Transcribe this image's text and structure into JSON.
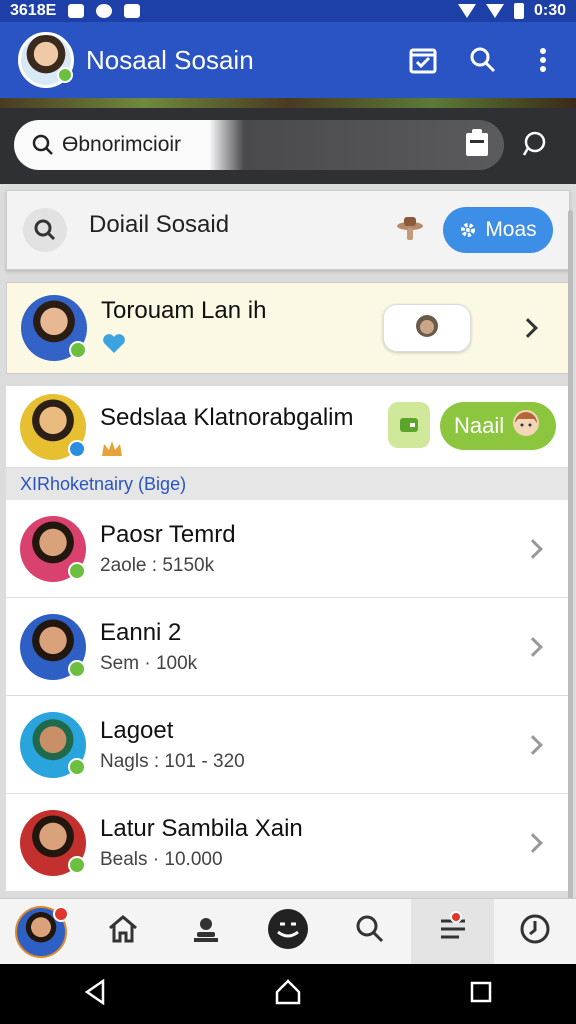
{
  "status_bar": {
    "left_text": "3618E",
    "time": "0:30"
  },
  "app_bar": {
    "title": "Nosaal Sosain",
    "avatar_icon": "profile-avatar",
    "actions": [
      "calendar-check-icon",
      "search-icon",
      "more-vert-icon"
    ]
  },
  "search": {
    "value": "Ɵbnorimcioir"
  },
  "detail": {
    "title": "Doiail Sosaid",
    "button_label": "Moas"
  },
  "rows": [
    {
      "name": "Torouam Lan ih",
      "sub": "",
      "verified": "green"
    },
    {
      "name": "Sedslaa Klatnorabgalim",
      "sub": "",
      "action_label": "Naail",
      "verified": "blue"
    },
    {
      "name": "Paosr Temrd",
      "sub": "2aole : 5150k",
      "verified": "green"
    },
    {
      "name": "Eanni 2",
      "sub": "Sem · 100k",
      "verified": "green"
    },
    {
      "name": "Lagoet",
      "sub": "Nagls : 101 - 320",
      "verified": "green"
    },
    {
      "name": "Latur Sambila Xain",
      "sub": "Beals · 10.000",
      "verified": "green"
    }
  ],
  "section_label": "XIRhoketnairy (Bige)",
  "colors": {
    "app_bar": "#2a54c4",
    "accent_blue": "#3d8ee6",
    "accent_green": "#8cc63f",
    "verified_green": "#6cbf3f"
  },
  "bottom_nav": [
    "profile-avatar",
    "home-icon",
    "user-stamp-icon",
    "emoji-icon",
    "search-icon",
    "list-icon",
    "clock-icon"
  ],
  "system_nav": [
    "back-icon",
    "home-icon",
    "recents-icon"
  ]
}
